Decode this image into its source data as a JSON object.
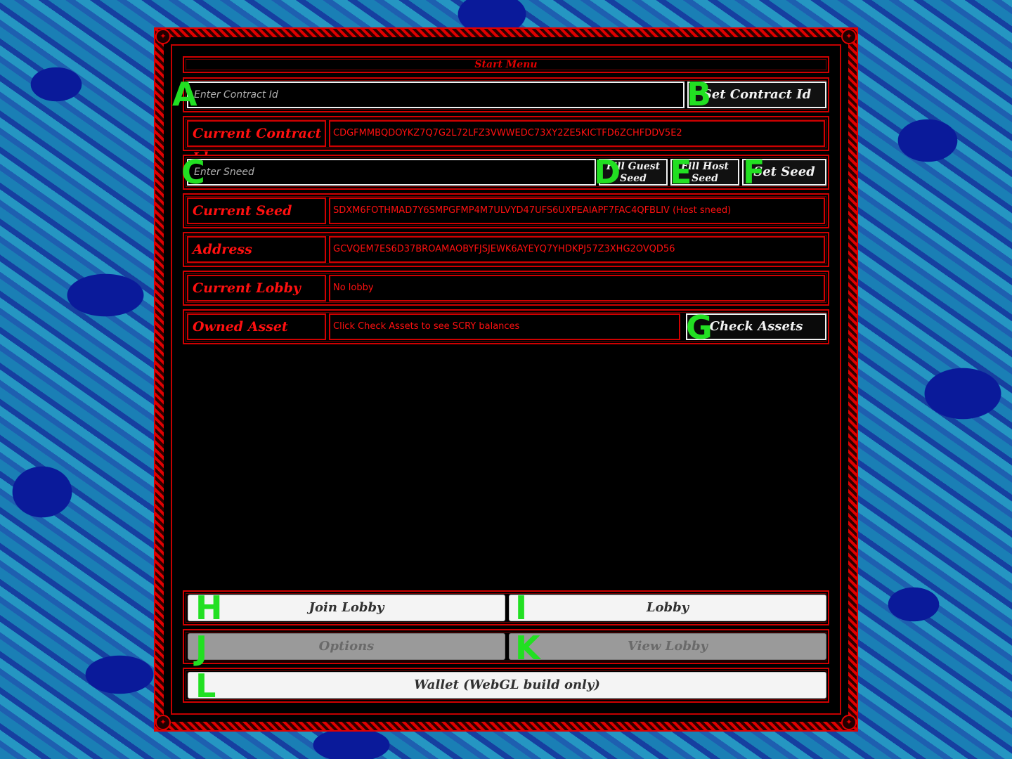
{
  "menu": {
    "title": "Start Menu"
  },
  "contract": {
    "input_placeholder": "Enter Contract Id",
    "set_button": "Set Contract Id",
    "current_label": "Current Contract Id",
    "current_value": "CDGFMMBQDOYKZ7Q7G2L72LFZ3VWWEDC73XY2ZE5KICTFD6ZCHFDDV5E2"
  },
  "seed": {
    "input_placeholder": "Enter Sneed",
    "fill_guest_button": "Fill Guest Seed",
    "fill_host_button": "Fill Host Seed",
    "set_button": "Set Seed",
    "current_label": "Current Seed",
    "current_value": "SDXM6FOTHMAD7Y6SMPGFMP4M7ULVYD47UFS6UXPEAIAPF7FAC4QFBLIV (Host sneed)"
  },
  "address": {
    "label": "Address",
    "value": "GCVQEM7ES6D37BROAMAOBYFJSJEWK6AYEYQ7YHDKPJ57Z3XHG2OVQD56"
  },
  "lobby": {
    "label": "Current Lobby",
    "value": "No lobby"
  },
  "asset": {
    "label": "Owned Asset",
    "value": "Click Check Assets to see SCRY balances",
    "check_button": "Check Assets"
  },
  "bottom": {
    "join_lobby": "Join Lobby",
    "lobby": "Lobby",
    "options": "Options",
    "view_lobby": "View Lobby",
    "wallet": "Wallet (WebGL build only)"
  },
  "markers": [
    "A",
    "B",
    "C",
    "D",
    "E",
    "F",
    "G",
    "H",
    "I",
    "J",
    "K",
    "L"
  ],
  "colors": {
    "accent": "#e00000",
    "panel": "#000000",
    "marker": "#22e022"
  }
}
